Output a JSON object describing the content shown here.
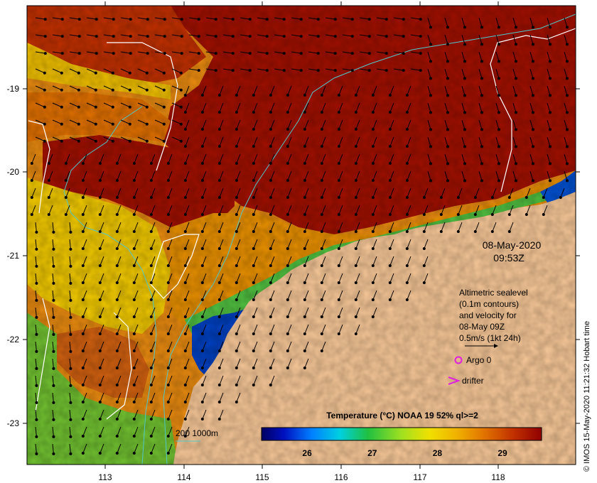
{
  "map": {
    "date_line1": "08-May-2020",
    "date_line2": "09:53Z",
    "legend_lines": [
      "Altimetric sealevel",
      "(0.1m contours)",
      "and velocity for",
      "08-May 09Z",
      "0.5m/s (1kt 24h)"
    ],
    "argo_label": "Argo 0",
    "drifter_label": "drifter",
    "bathy_label": "200  1000m",
    "credit": "© IMOS 15-May-2020 11:21:32 Hobart time",
    "colorbar": {
      "title": "Temperature (°C) NOAA 19 52% ql>=2",
      "ticks": [
        "26",
        "27",
        "28",
        "29"
      ],
      "min": 25.3,
      "max": 29.6,
      "tick_values": [
        26,
        27,
        28,
        29
      ]
    },
    "x_ticks": [
      "113",
      "114",
      "115",
      "116",
      "117",
      "118"
    ],
    "y_ticks": [
      "-19",
      "-20",
      "-21",
      "-22",
      "-23"
    ],
    "colors": {
      "land": "#f8c898",
      "hot": "#a01000",
      "coast_cold": "#003090",
      "argo": "#e020e0",
      "drifter": "#e020e0",
      "bathy": "#50c8c8",
      "contour": "#ffffff"
    }
  }
}
